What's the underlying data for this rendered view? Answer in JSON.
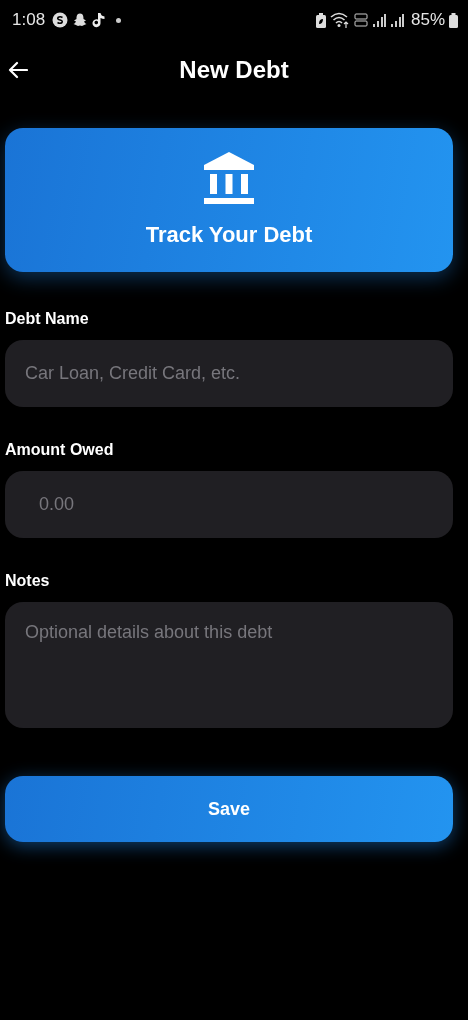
{
  "status_bar": {
    "time": "1:08",
    "battery": "85%"
  },
  "header": {
    "title": "New Debt"
  },
  "banner": {
    "title": "Track Your Debt"
  },
  "fields": [
    {
      "label": "Debt Name",
      "placeholder": "Car Loan, Credit Card, etc.",
      "kind": "text"
    },
    {
      "label": "Amount Owed",
      "placeholder": "0.00",
      "kind": "amount"
    },
    {
      "label": "Notes",
      "placeholder": "Optional details about this debt",
      "kind": "multiline"
    }
  ],
  "save_button": {
    "label": "Save"
  }
}
